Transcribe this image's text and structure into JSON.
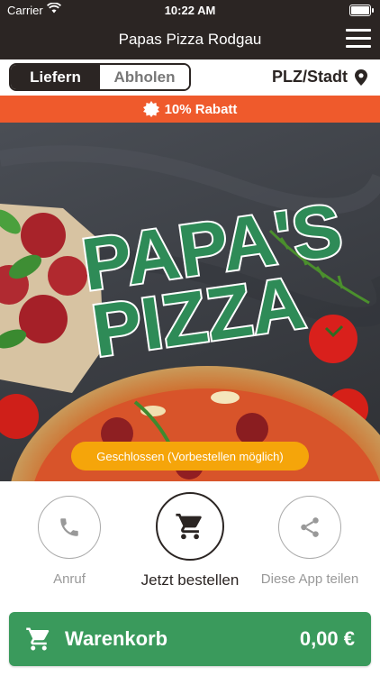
{
  "status_bar": {
    "carrier": "Carrier",
    "time": "10:22 AM"
  },
  "header": {
    "title": "Papas Pizza Rodgau"
  },
  "delivery_toggle": {
    "deliver_label": "Liefern",
    "pickup_label": "Abholen",
    "selected": "Liefern"
  },
  "location": {
    "label": "PLZ/Stadt"
  },
  "discount": {
    "label": "10% Rabatt"
  },
  "hero": {
    "logo_line1": "PAPA'S",
    "logo_line2": "PIZZA",
    "status_badge": "Geschlossen (Vorbestellen möglich)"
  },
  "actions": {
    "call_label": "Anruf",
    "order_label": "Jetzt bestellen",
    "share_label": "Diese App teilen"
  },
  "cart": {
    "label": "Warenkorb",
    "total": "0,00 €"
  },
  "colors": {
    "bar_dark": "#2b2523",
    "discount": "#ef5a2c",
    "cart_green": "#3a9a5c",
    "badge_orange": "#f5a50a",
    "logo_green": "#2e8b57"
  },
  "icons": [
    "wifi-icon",
    "battery-icon",
    "menu-icon",
    "location-pin-icon",
    "discount-badge-icon",
    "phone-icon",
    "cart-icon",
    "share-icon"
  ]
}
